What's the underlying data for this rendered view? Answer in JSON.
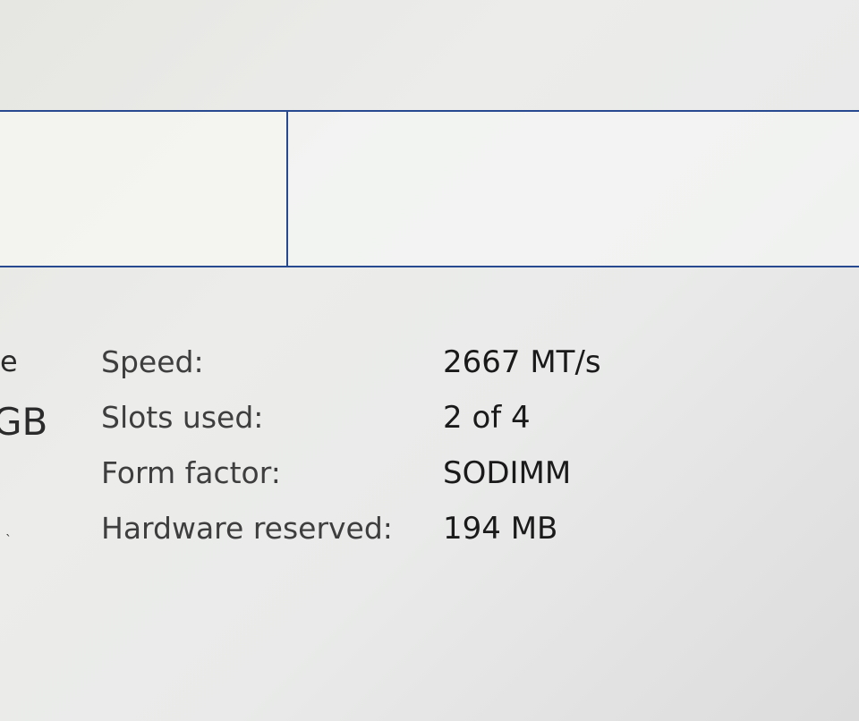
{
  "left_fragments": {
    "line1": "e",
    "line2": "GB",
    "line3": "ˎ"
  },
  "memory_properties": [
    {
      "label": "Speed:",
      "value": "2667 MT/s"
    },
    {
      "label": "Slots used:",
      "value": "2 of 4"
    },
    {
      "label": "Form factor:",
      "value": "SODIMM"
    },
    {
      "label": "Hardware reserved:",
      "value": "194 MB"
    }
  ],
  "colors": {
    "composition_border": "#27498f",
    "label_text": "#3e3e3e",
    "value_text": "#1a1a1a"
  }
}
